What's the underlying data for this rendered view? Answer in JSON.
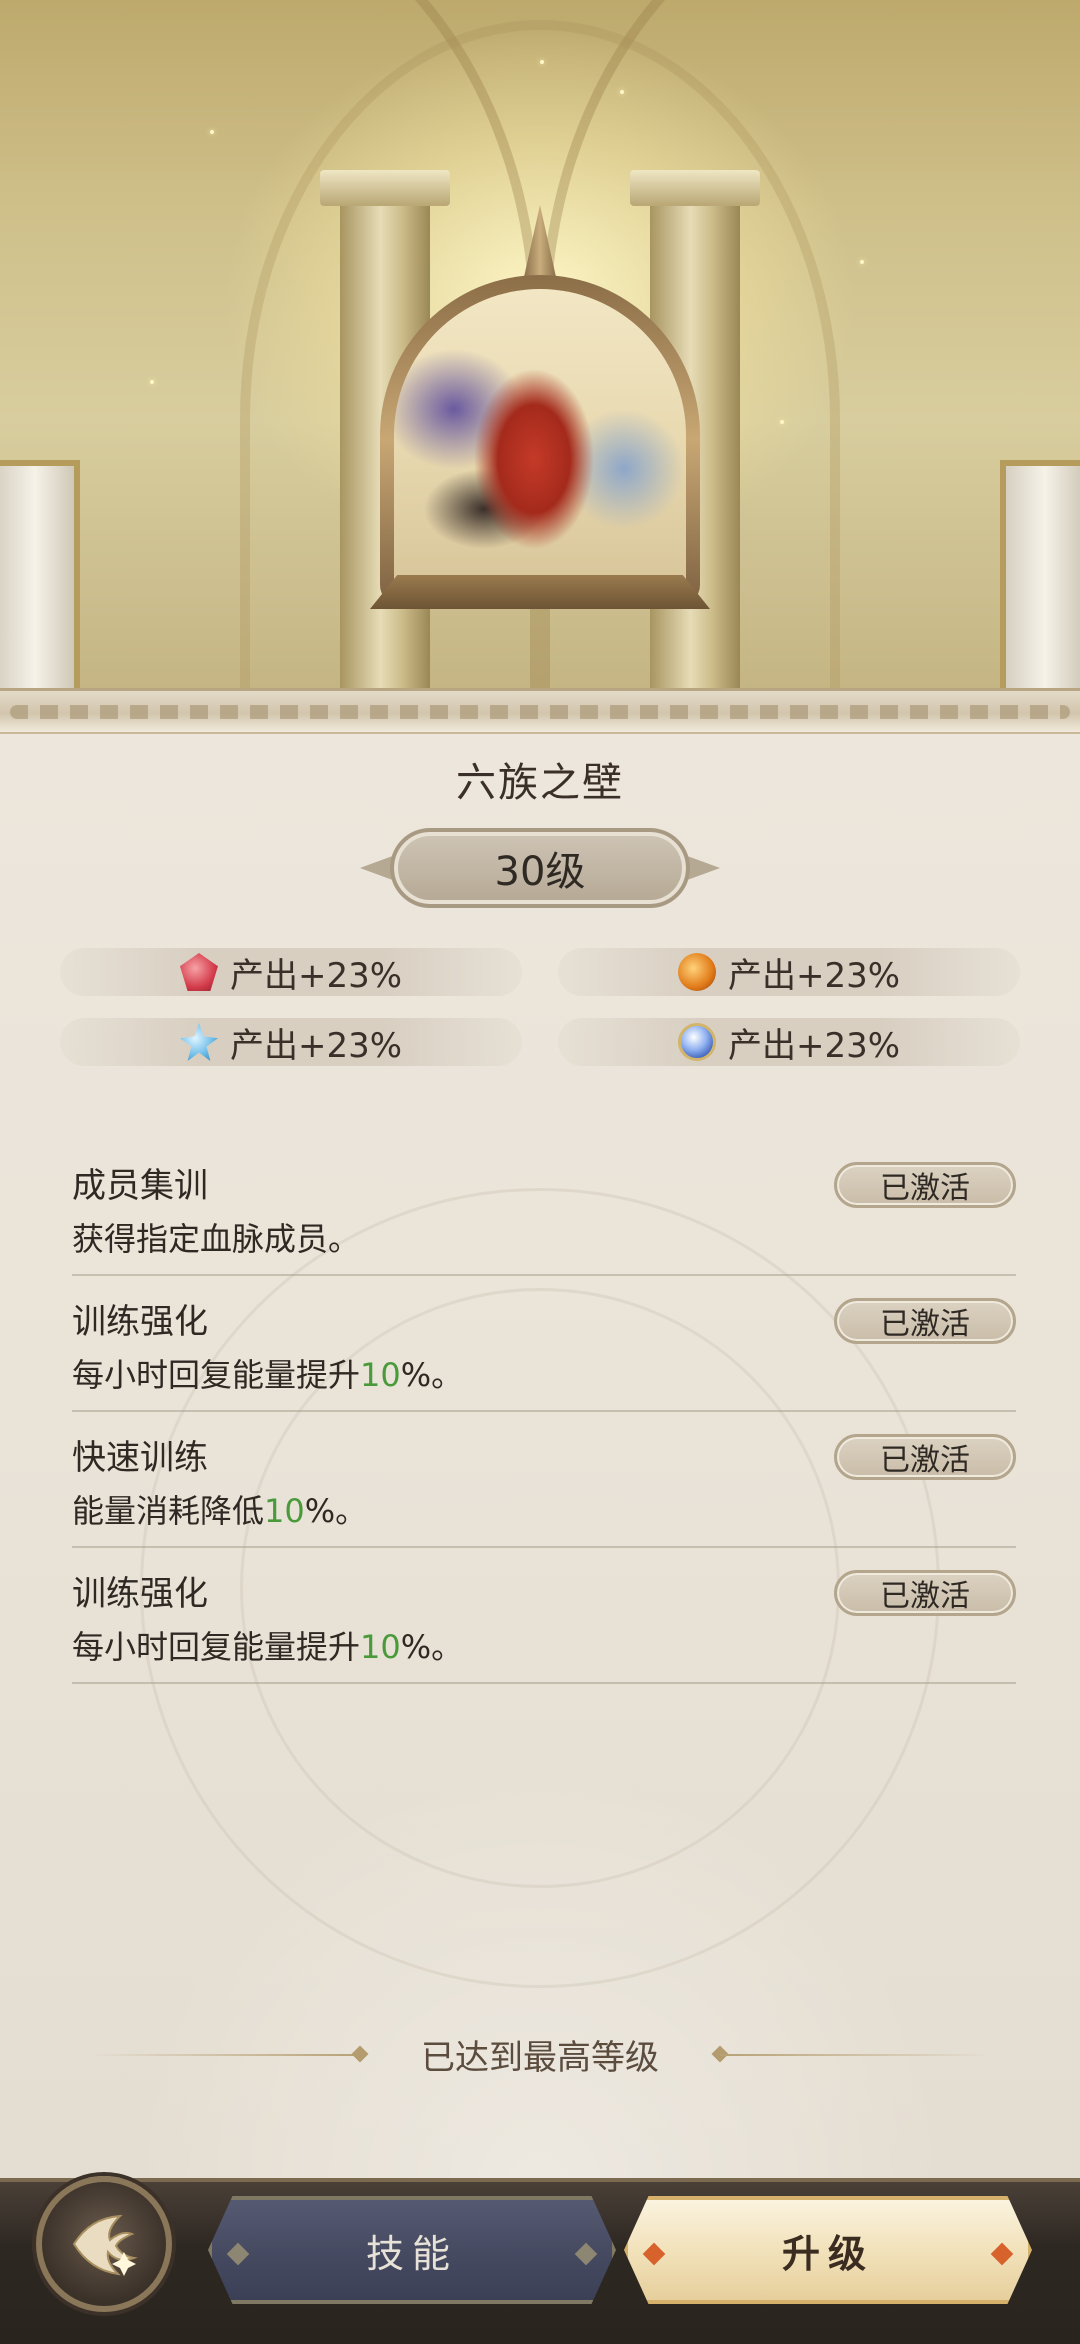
{
  "building": {
    "title": "六族之壁",
    "level": "30级"
  },
  "stats": [
    {
      "icon": "red-crystal-icon",
      "text": "产出+23%"
    },
    {
      "icon": "orange-orb-icon",
      "text": "产出+23%"
    },
    {
      "icon": "blue-crystal-icon",
      "text": "产出+23%"
    },
    {
      "icon": "blue-sphere-icon",
      "text": "产出+23%"
    }
  ],
  "skills": [
    {
      "name": "成员集训",
      "desc_pre": "获得指定血脉成员。",
      "desc_value": "",
      "desc_post": "",
      "status": "已激活"
    },
    {
      "name": "训练强化",
      "desc_pre": "每小时回复能量提升",
      "desc_value": "10",
      "desc_post": "%。",
      "status": "已激活"
    },
    {
      "name": "快速训练",
      "desc_pre": "能量消耗降低",
      "desc_value": "10",
      "desc_post": "%。",
      "status": "已激活"
    },
    {
      "name": "训练强化",
      "desc_pre": "每小时回复能量提升",
      "desc_value": "10",
      "desc_post": "%。",
      "status": "已激活"
    }
  ],
  "max_level_text": "已达到最高等级",
  "bottom_nav": {
    "skill_tab": "技能",
    "upgrade_tab": "升级"
  },
  "colors": {
    "highlight_value": "#4a9a3c",
    "active_tab": "#f2e2bb",
    "inactive_tab": "#474b62"
  }
}
